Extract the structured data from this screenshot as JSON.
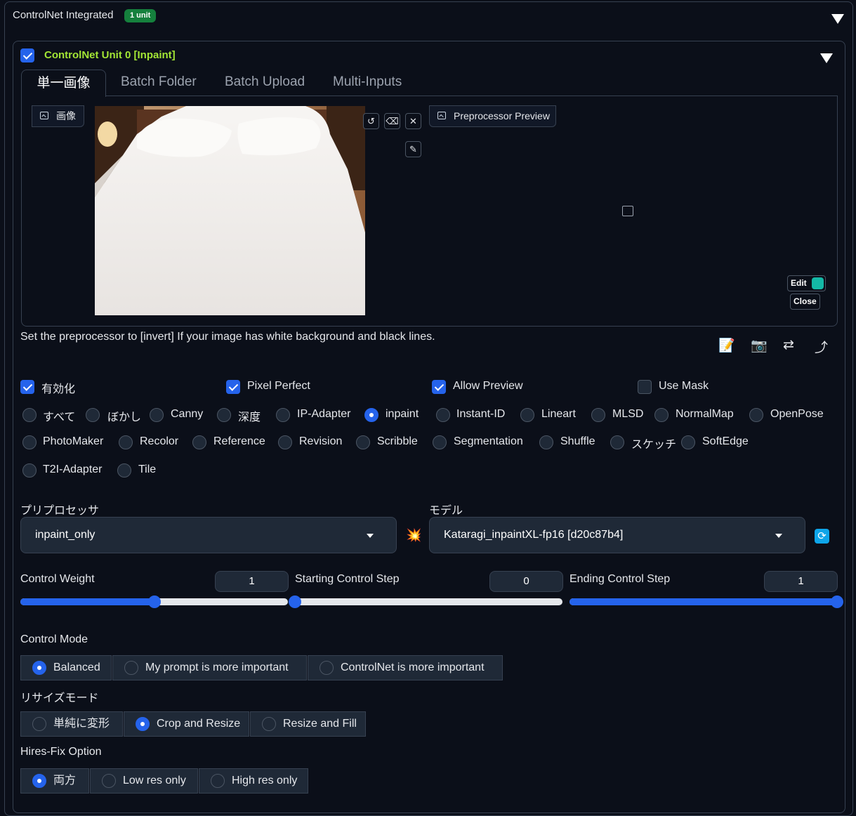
{
  "accordion": {
    "title": "ControlNet Integrated",
    "badge": "1 unit"
  },
  "unit": {
    "title": "ControlNet Unit 0  [Inpaint]",
    "enabled": true
  },
  "tabs": [
    {
      "label": "単一画像",
      "active": true
    },
    {
      "label": "Batch Folder",
      "active": false
    },
    {
      "label": "Batch Upload",
      "active": false
    },
    {
      "label": "Multi-Inputs",
      "active": false
    }
  ],
  "image_panel": {
    "label": "画像",
    "preview_label": "Preprocessor Preview",
    "edit_label": "Edit",
    "close_label": "Close"
  },
  "hint": "Set the preprocessor to [invert] If your image has white background and black lines.",
  "options": [
    {
      "label": "有効化",
      "checked": true
    },
    {
      "label": "Pixel Perfect",
      "checked": true
    },
    {
      "label": "Allow Preview",
      "checked": true
    },
    {
      "label": "Use Mask",
      "checked": false
    }
  ],
  "control_types": [
    "すべて",
    "ぼかし",
    "Canny",
    "深度",
    "IP-Adapter",
    "inpaint",
    "Instant-ID",
    "Lineart",
    "MLSD",
    "NormalMap",
    "OpenPose",
    "PhotoMaker",
    "Recolor",
    "Reference",
    "Revision",
    "Scribble",
    "Segmentation",
    "Shuffle",
    "スケッチ",
    "SoftEdge",
    "T2I-Adapter",
    "Tile"
  ],
  "selected_control_type": "inpaint",
  "preprocessor": {
    "label": "プリプロセッサ",
    "value": "inpaint_only"
  },
  "model": {
    "label": "モデル",
    "value": "Kataragi_inpaintXL-fp16 [d20c87b4]"
  },
  "sliders": [
    {
      "label": "Control Weight",
      "value": "1",
      "fraction": 0.5
    },
    {
      "label": "Starting Control Step",
      "value": "0",
      "fraction": 0.0
    },
    {
      "label": "Ending Control Step",
      "value": "1",
      "fraction": 1.0
    }
  ],
  "control_mode": {
    "label": "Control Mode",
    "options": [
      "Balanced",
      "My prompt is more important",
      "ControlNet is more important"
    ],
    "selected": "Balanced"
  },
  "resize_mode": {
    "label": "リサイズモード",
    "options": [
      "単純に変形",
      "Crop and Resize",
      "Resize and Fill"
    ],
    "selected": "Crop and Resize"
  },
  "hires_fix": {
    "label": "Hires-Fix Option",
    "options": [
      "両方",
      "Low res only",
      "High res only"
    ],
    "selected": "両方"
  },
  "colors": {
    "accent": "#2563eb",
    "unit_title": "#a3e635",
    "badge": "#15803d",
    "background": "#0b0f19"
  }
}
